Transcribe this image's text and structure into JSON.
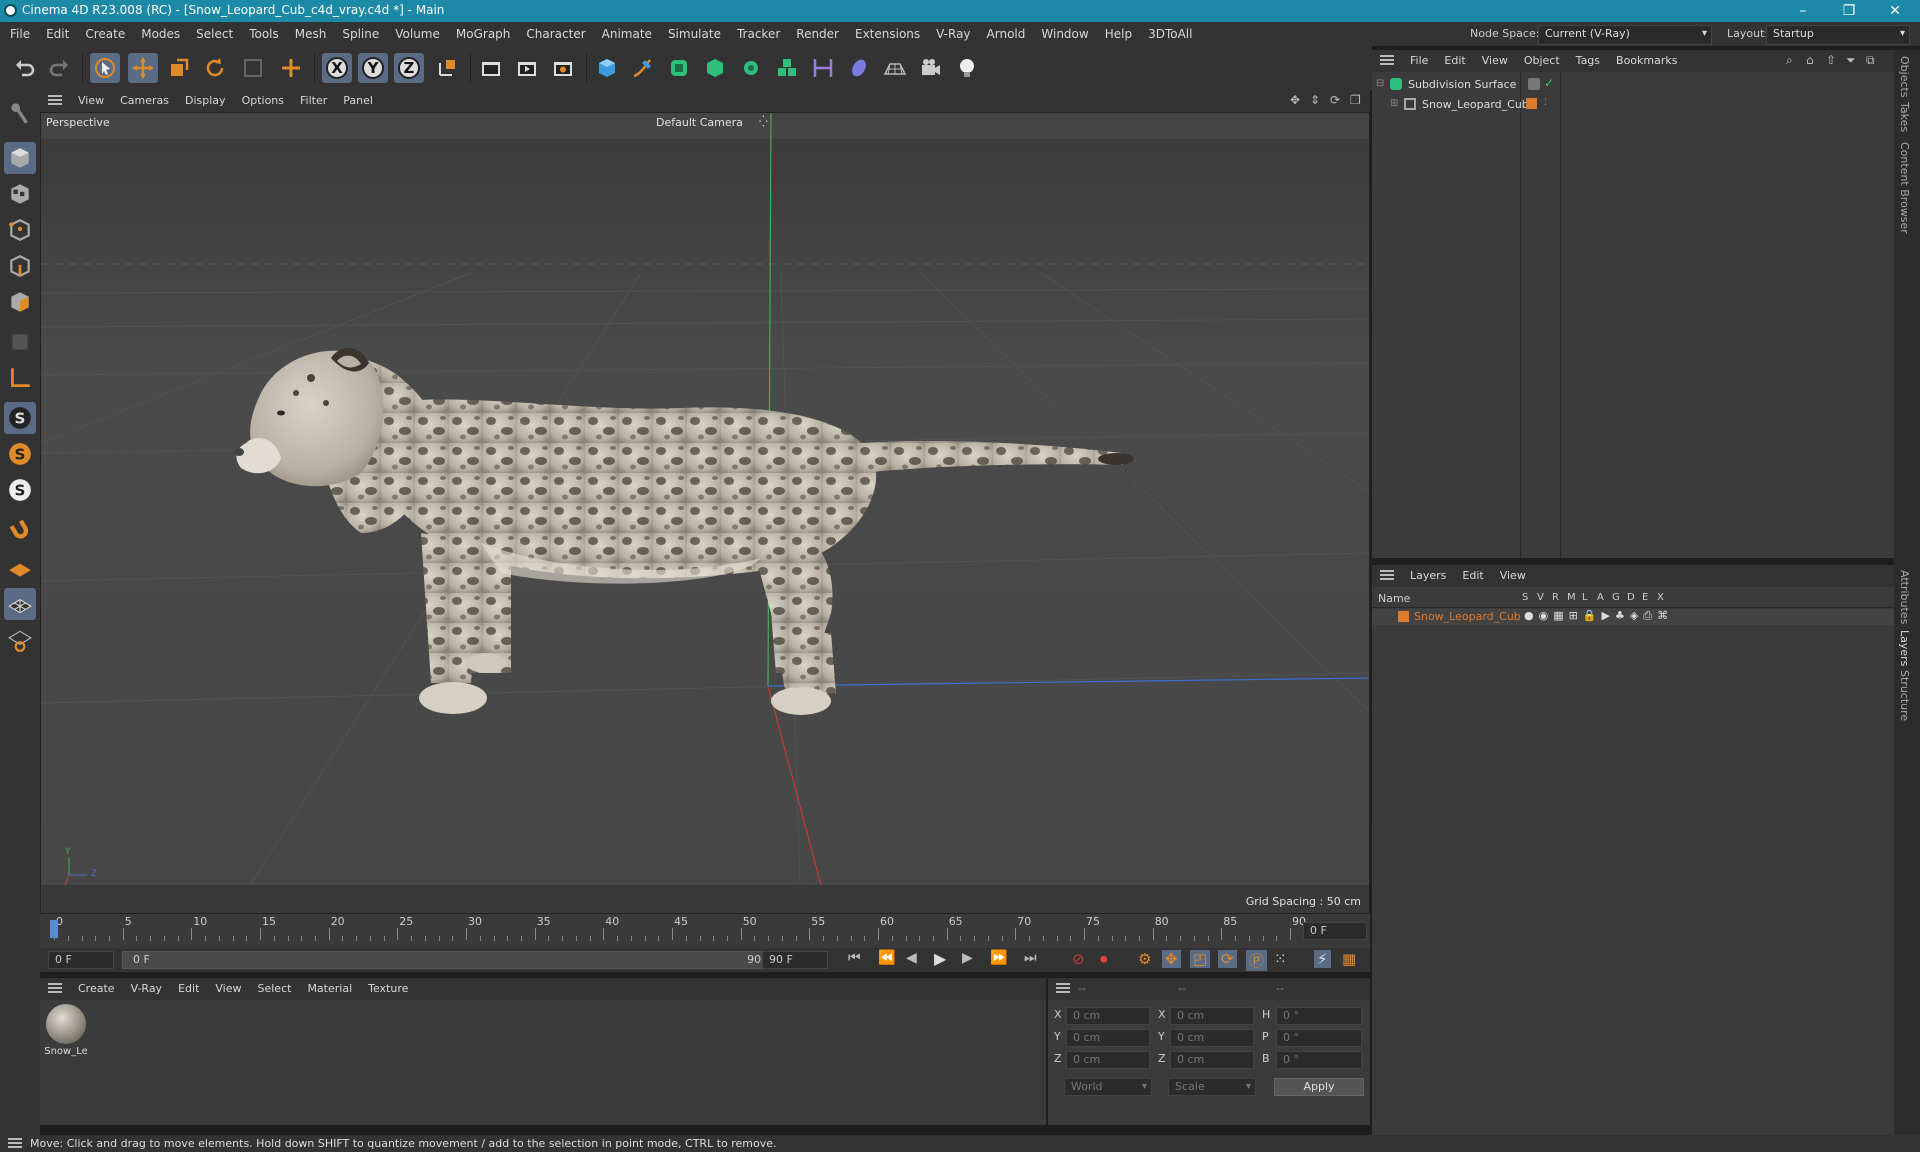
{
  "window": {
    "title": "Cinema 4D R23.008 (RC) - [Snow_Leopard_Cub_c4d_vray.c4d *] - Main",
    "controls": {
      "minimize": "–",
      "restore": "❐",
      "close": "✕"
    }
  },
  "menubar": {
    "items": [
      "File",
      "Edit",
      "Create",
      "Modes",
      "Select",
      "Tools",
      "Mesh",
      "Spline",
      "Volume",
      "MoGraph",
      "Character",
      "Animate",
      "Simulate",
      "Tracker",
      "Render",
      "Extensions",
      "V-Ray",
      "Arnold",
      "Window",
      "Help",
      "3DToAll"
    ],
    "node_space_label": "Node Space:",
    "node_space_value": "Current (V-Ray)",
    "layout_label": "Layout:",
    "layout_value": "Startup"
  },
  "toolbar": {
    "axis_x": "X",
    "axis_y": "Y",
    "axis_z": "Z"
  },
  "viewport": {
    "menu": [
      "View",
      "Cameras",
      "Display",
      "Options",
      "Filter",
      "Panel"
    ],
    "label": "Perspective",
    "camera": "Default Camera",
    "grid_spacing": "Grid Spacing : 50 cm",
    "axis_y": "Y",
    "axis_z": "Z",
    "axis_x": "X"
  },
  "timeline": {
    "ticks": [
      "0",
      "5",
      "10",
      "15",
      "20",
      "25",
      "30",
      "35",
      "40",
      "45",
      "50",
      "55",
      "60",
      "65",
      "70",
      "75",
      "80",
      "85",
      "90"
    ],
    "current_frame": "0 F",
    "start_field": "0 F",
    "range_start": "0 F",
    "range_end": "90 F",
    "end_field": "90 F"
  },
  "materials": {
    "menu": [
      "Create",
      "V-Ray",
      "Edit",
      "View",
      "Select",
      "Material",
      "Texture"
    ],
    "items": [
      {
        "label": "Snow_Le"
      }
    ]
  },
  "coordinates": {
    "headers": [
      "--",
      "--",
      "--"
    ],
    "rows": [
      {
        "a": "X",
        "av": "0 cm",
        "b": "X",
        "bv": "0 cm",
        "c": "H",
        "cv": "0 °"
      },
      {
        "a": "Y",
        "av": "0 cm",
        "b": "Y",
        "bv": "0 cm",
        "c": "P",
        "cv": "0 °"
      },
      {
        "a": "Z",
        "av": "0 cm",
        "b": "Z",
        "bv": "0 cm",
        "c": "B",
        "cv": "0 °"
      }
    ],
    "world": "World",
    "scale": "Scale",
    "apply": "Apply"
  },
  "objects": {
    "menu": [
      "File",
      "Edit",
      "View",
      "Object",
      "Tags",
      "Bookmarks"
    ],
    "items": [
      {
        "name": "Subdivision Surface"
      },
      {
        "name": "Snow_Leopard_Cub"
      }
    ]
  },
  "layers": {
    "menu": [
      "Layers",
      "Edit",
      "View"
    ],
    "col_name": "Name",
    "columns": [
      "S",
      "V",
      "R",
      "M",
      "L",
      "A",
      "G",
      "D",
      "E",
      "X"
    ],
    "rows": [
      {
        "name": "Snow_Leopard_Cub",
        "color": "#e07a2a"
      }
    ]
  },
  "side_tabs": [
    "Objects",
    "Takes",
    "Content Browser",
    "Attributes",
    "Layers",
    "Structure"
  ],
  "status": "Move: Click and drag to move elements. Hold down SHIFT to quantize movement / add to the selection in point mode, CTRL to remove.",
  "colors": {
    "accent": "#1c8aa6",
    "selected": "#5a6b86",
    "orange": "#e07a2a"
  }
}
